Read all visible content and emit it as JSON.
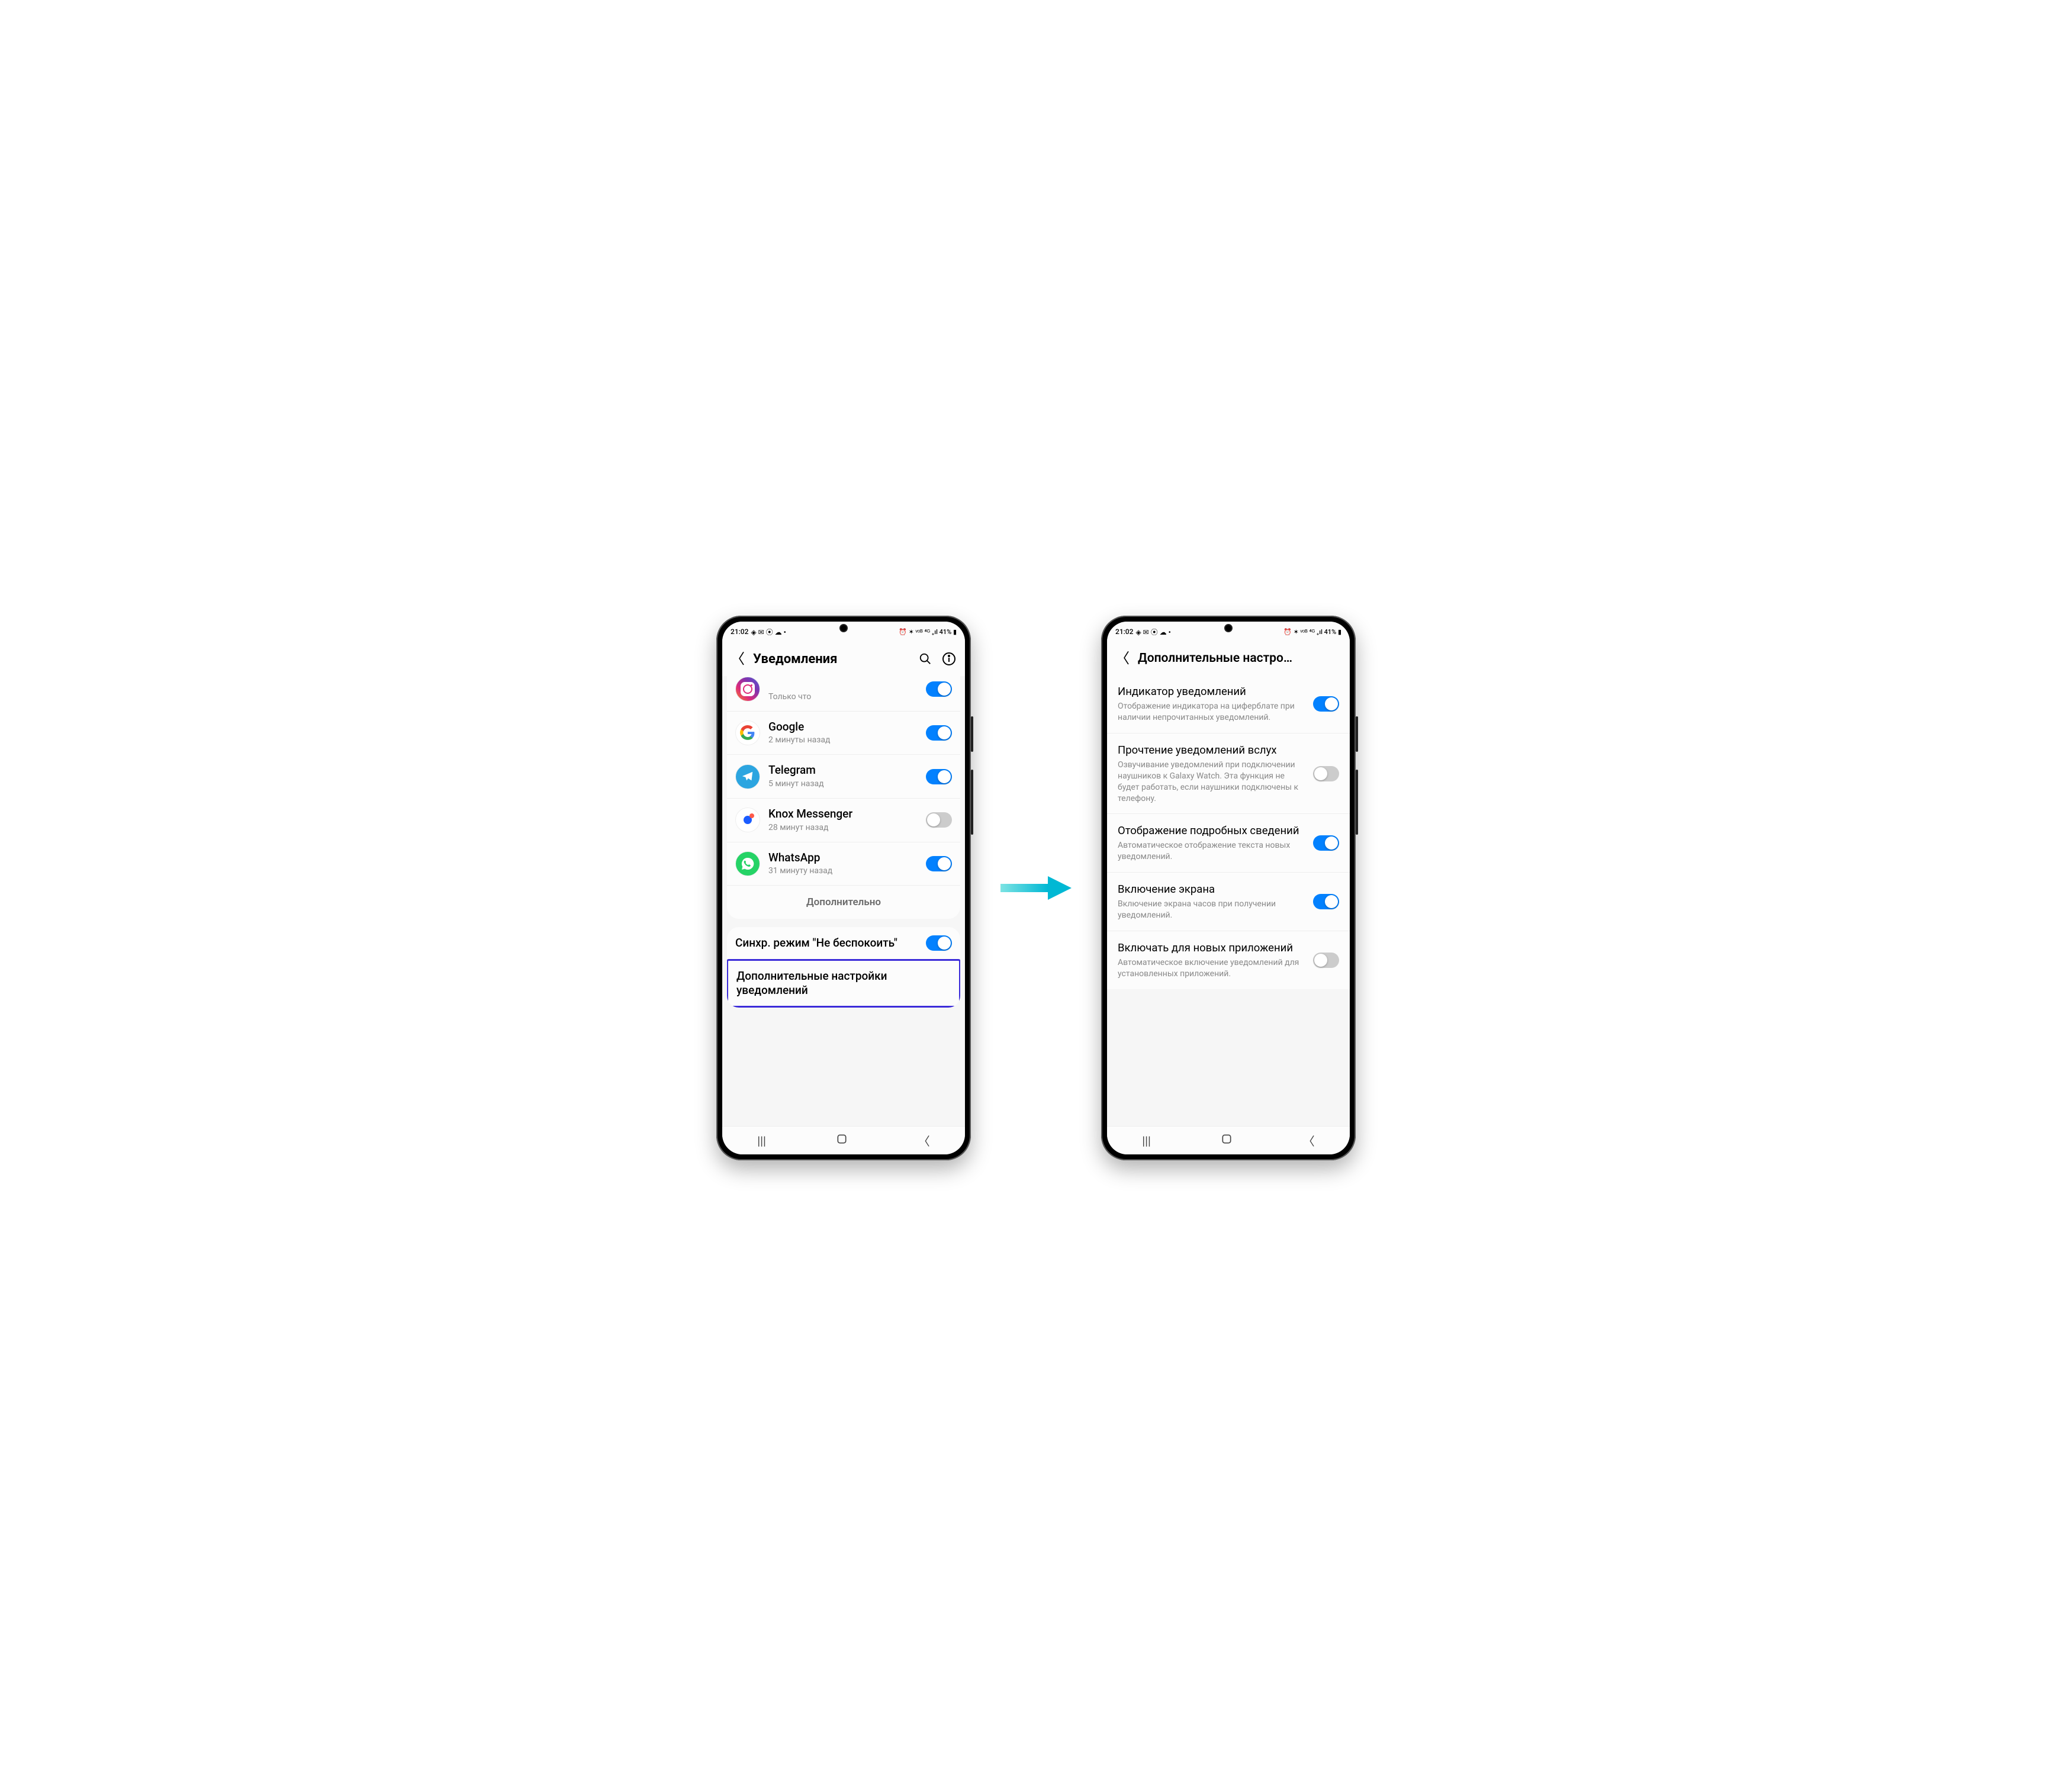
{
  "status": {
    "time": "21:02",
    "left_icons": "◈ ✉ ⦿ ☁ •",
    "right_icons": "⏰ ✶ ᵛᵒᴮ ⁴ᴳ ₊ıl 41% ▮",
    "battery": "41%"
  },
  "left": {
    "title": "Уведомления",
    "apps": [
      {
        "name": "Instagram",
        "sub": "Только что",
        "on": true,
        "icon": "ig",
        "cutoff": true
      },
      {
        "name": "Google",
        "sub": "2 минуты назад",
        "on": true,
        "icon": "google"
      },
      {
        "name": "Telegram",
        "sub": "5 минут назад",
        "on": true,
        "icon": "tg"
      },
      {
        "name": "Knox Messenger",
        "sub": "28 минут назад",
        "on": false,
        "icon": "knox"
      },
      {
        "name": "WhatsApp",
        "sub": "31 минуту назад",
        "on": true,
        "icon": "wa"
      }
    ],
    "more": "Дополнительно",
    "dnd_title": "Синхр. режим \"Не беспокоить\"",
    "dnd_on": true,
    "adv": "Дополнительные настройки уведомлений"
  },
  "right": {
    "title": "Дополнительные настро…",
    "settings": [
      {
        "title": "Индикатор уведомлений",
        "desc": "Отображение индикатора на циферблате при наличии непрочитанных уведомлений.",
        "on": true
      },
      {
        "title": "Прочтение уведомлений вслух",
        "desc": "Озвучивание уведомлений при подключении наушников к Galaxy Watch. Эта функция не будет работать, если наушники подключены к телефону.",
        "on": false
      },
      {
        "title": "Отображение подробных сведений",
        "desc": "Автоматическое отображение текста новых уведомлений.",
        "on": true
      },
      {
        "title": "Включение экрана",
        "desc": "Включение экрана часов при получении уведомлений.",
        "on": true
      },
      {
        "title": "Включать для новых приложений",
        "desc": "Автоматическое включение уведомлений для установленных приложений.",
        "on": false
      }
    ]
  }
}
